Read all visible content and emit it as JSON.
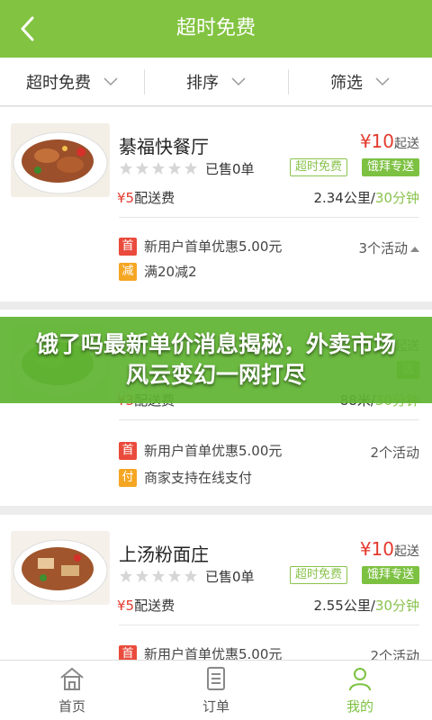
{
  "header": {
    "title": "超时免费"
  },
  "filters": [
    {
      "label": "超时免费"
    },
    {
      "label": "排序"
    },
    {
      "label": "筛选"
    }
  ],
  "colors": {
    "brand": "#82c341",
    "price": "#e23b2e",
    "tag_green": "#7dc142",
    "badge_red": "#ea4b3c",
    "badge_orange": "#f5a623"
  },
  "restaurants": [
    {
      "name": "綦福快餐厅",
      "price_value": "¥10",
      "price_suffix": "起送",
      "rating_stars": 0,
      "sold": "已售0单",
      "tag_outline": "超时免费",
      "tag_solid": "饿拜专送",
      "fee_value": "¥5",
      "fee_label": "配送费",
      "distance": "2.34公里/",
      "time": "30分钟",
      "promos": [
        {
          "badge": "首",
          "badge_color": "red",
          "text": "新用户首单优惠5.00元"
        },
        {
          "badge": "减",
          "badge_color": "orange",
          "text": "满20减2"
        }
      ],
      "activity": "3个活动"
    },
    {
      "name": "",
      "price_value": "",
      "price_suffix": "起送",
      "rating_stars": 0,
      "sold": "",
      "tag_outline": "",
      "tag_solid": "送",
      "fee_value": "¥3",
      "fee_label": "配送费",
      "distance": "88米/",
      "time": "30分钟",
      "promos": [
        {
          "badge": "首",
          "badge_color": "red",
          "text": "新用户首单优惠5.00元"
        },
        {
          "badge": "付",
          "badge_color": "orange",
          "text": "商家支持在线支付"
        }
      ],
      "activity": "2个活动"
    },
    {
      "name": "上汤粉面庄",
      "price_value": "¥10",
      "price_suffix": "起送",
      "rating_stars": 0,
      "sold": "已售0单",
      "tag_outline": "超时免费",
      "tag_solid": "饿拜专送",
      "fee_value": "¥5",
      "fee_label": "配送费",
      "distance": "2.55公里/",
      "time": "30分钟",
      "promos": [
        {
          "badge": "首",
          "badge_color": "red",
          "text": "新用户首单优惠5.00元"
        }
      ],
      "activity": "2个活动"
    }
  ],
  "banner": {
    "text": "饿了吗最新单价消息揭秘，外卖市场风云变幻一网打尽"
  },
  "tabbar": [
    {
      "label": "首页",
      "icon": "home-icon",
      "active": false
    },
    {
      "label": "订单",
      "icon": "order-icon",
      "active": false
    },
    {
      "label": "我的",
      "icon": "user-icon",
      "active": true
    }
  ]
}
